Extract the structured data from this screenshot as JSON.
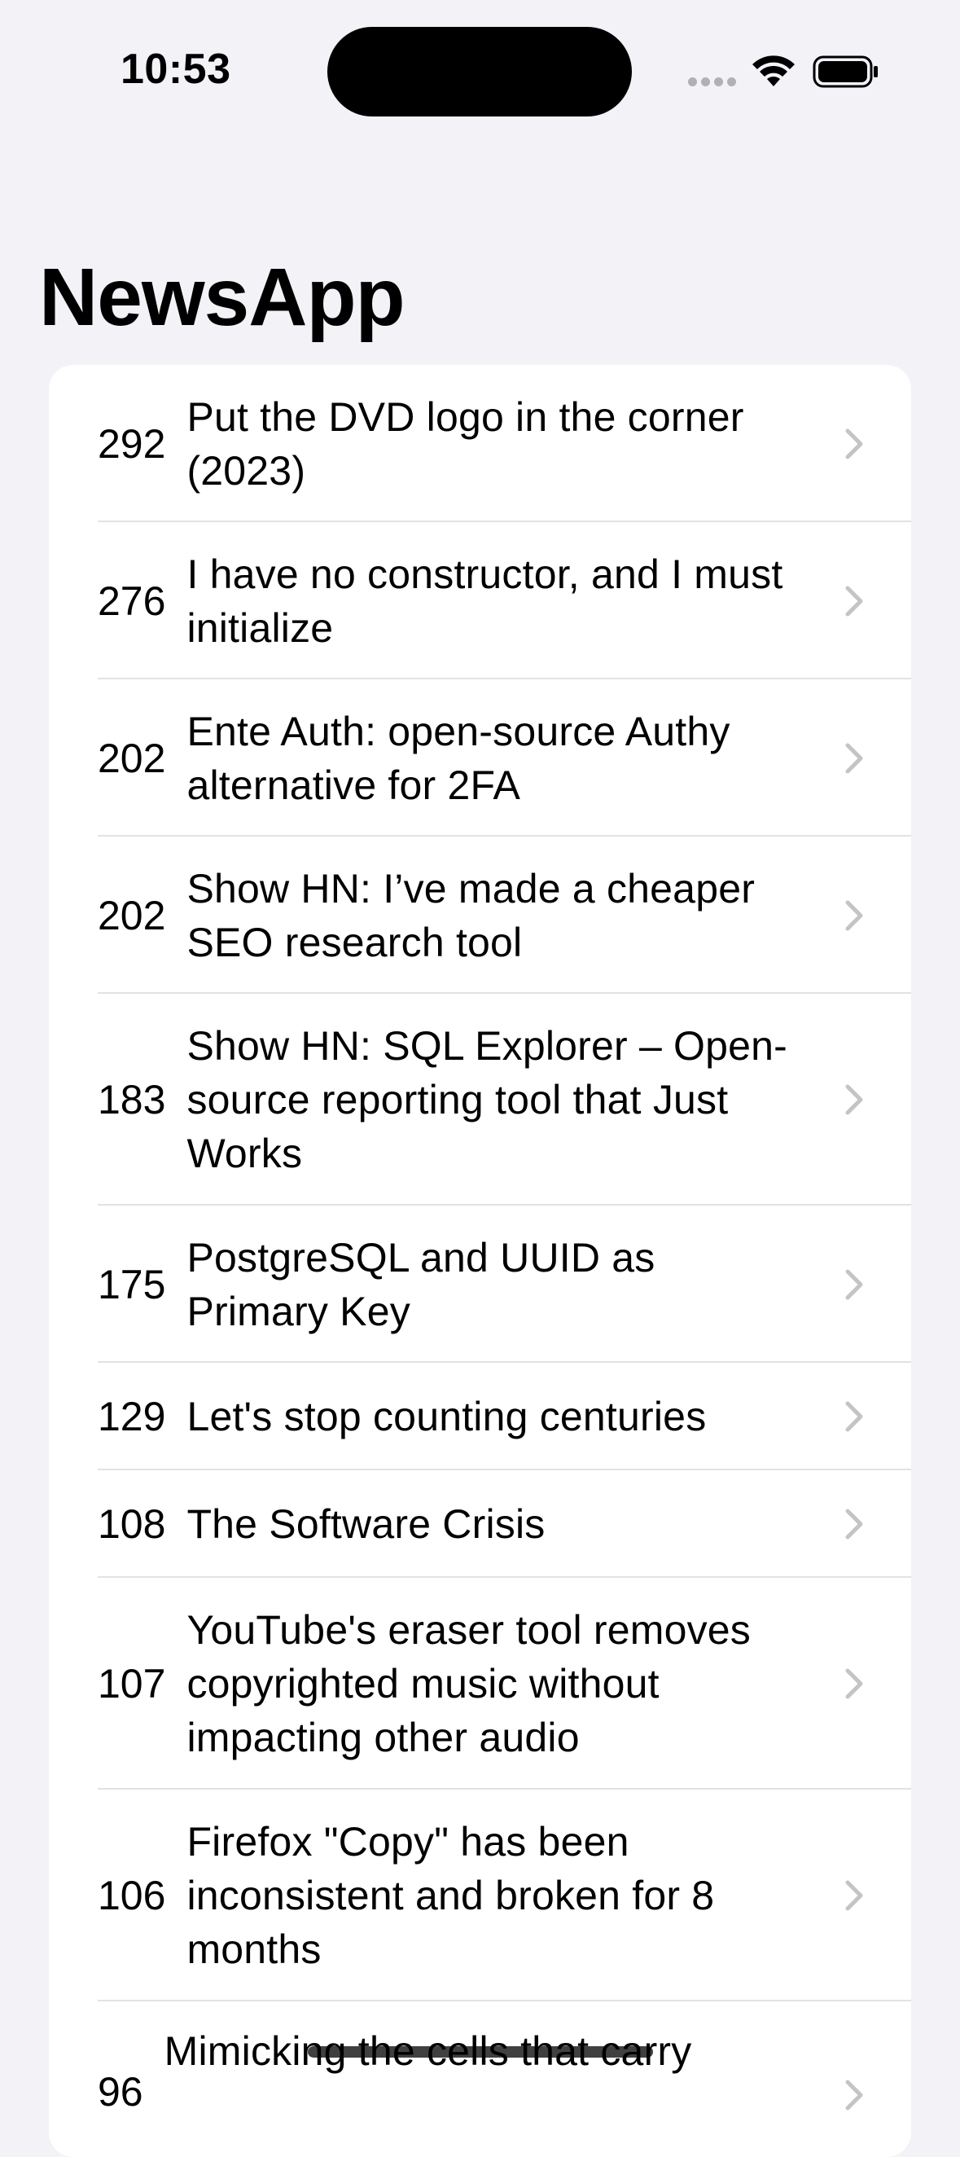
{
  "status_bar": {
    "time": "10:53"
  },
  "nav": {
    "title": "NewsApp"
  },
  "stories": [
    {
      "points": "292",
      "title": "Put the DVD logo in the corner (2023)"
    },
    {
      "points": "276",
      "title": "I have no constructor, and I must initialize"
    },
    {
      "points": "202",
      "title": "Ente Auth: open-source Authy alternative for 2FA"
    },
    {
      "points": "202",
      "title": "Show HN: I’ve made a cheaper SEO research tool"
    },
    {
      "points": "183",
      "title": "Show HN: SQL Explorer – Open-source reporting tool that Just Works"
    },
    {
      "points": "175",
      "title": "PostgreSQL and UUID as Primary Key"
    },
    {
      "points": "129",
      "title": "Let's stop counting centuries"
    },
    {
      "points": "108",
      "title": "The Software Crisis"
    },
    {
      "points": "107",
      "title": "YouTube's eraser tool removes copyrighted music without impacting other audio"
    },
    {
      "points": "106",
      "title": "Firefox \"Copy\" has been inconsistent and broken for 8 months"
    },
    {
      "points": "96",
      "title": "Mimicking the cells that carry"
    }
  ],
  "icons": {
    "chevron": "chevron-right-icon",
    "wifi": "wifi-icon",
    "battery": "battery-icon",
    "signal": "cellular-signal-icon"
  },
  "colors": {
    "background": "#f2f2f7",
    "card": "#ffffff",
    "chevron": "#c4c4c7",
    "separator": "#e2e2e6"
  }
}
